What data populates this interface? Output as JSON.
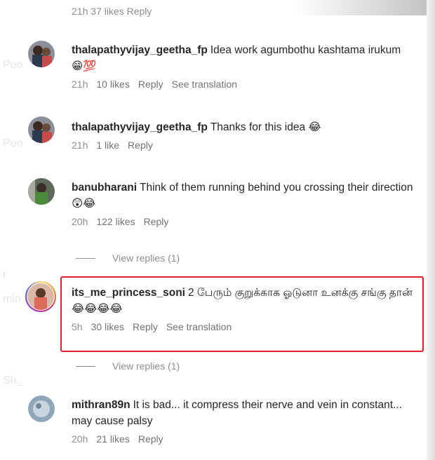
{
  "top_partial": {
    "text": "21h  37 likes  Reply"
  },
  "ghost_labels": [
    "Poo",
    "Poo",
    "r",
    "min",
    "Sh_"
  ],
  "comments": [
    {
      "username": "thalapathyvijay_geetha_fp",
      "text": "Idea work agumbothu kashtama irukum",
      "emoji": "😁💯",
      "time": "21h",
      "likes": "10 likes",
      "reply": "Reply",
      "translation": "See translation"
    },
    {
      "username": "thalapathyvijay_geetha_fp",
      "text": "Thanks for this idea",
      "emoji": "😂",
      "time": "21h",
      "likes": "1 like",
      "reply": "Reply"
    },
    {
      "username": "banubharani",
      "text": "Think of them running behind you crossing their direction",
      "emoji": "😲😂",
      "time": "20h",
      "likes": "122 likes",
      "reply": "Reply",
      "view_replies": "View replies (1)"
    },
    {
      "username": "its_me_princess_soni",
      "text": "2 பேரும் குறுக்காக ஓடுனா உனக்கு சங்கு தான்",
      "emoji": "😂😂😂😂",
      "time": "5h",
      "likes": "30 likes",
      "reply": "Reply",
      "translation": "See translation",
      "view_replies": "View replies (1)"
    },
    {
      "username": "mithran89n",
      "text": "It is bad... it compress their nerve and vein in constant... may cause palsy",
      "time": "20h",
      "likes": "21 likes",
      "reply": "Reply"
    }
  ],
  "colors": {
    "highlight_border": "#e0212b",
    "meta_text": "#8e8e8e",
    "primary_text": "#262626"
  }
}
